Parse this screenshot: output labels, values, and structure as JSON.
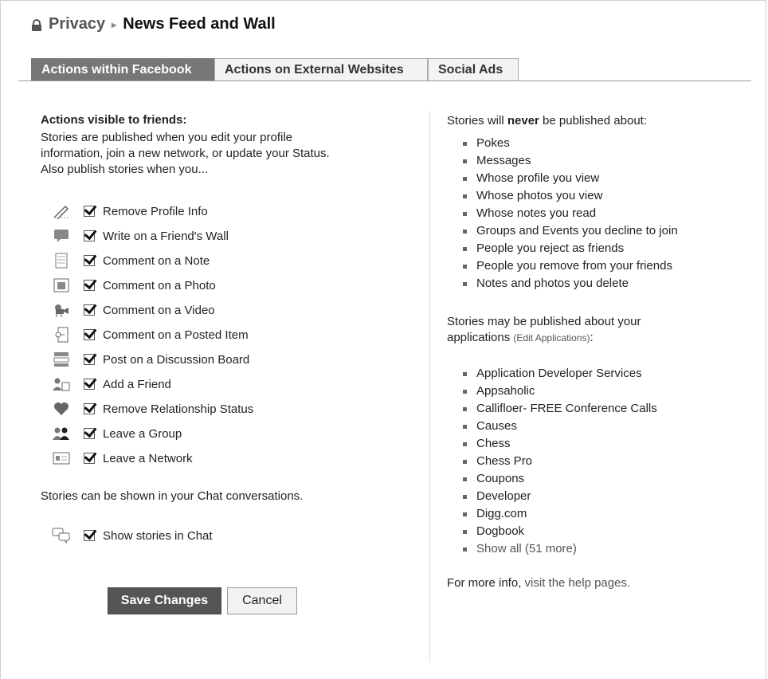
{
  "header": {
    "privacy": "Privacy",
    "separator": "▸",
    "current": "News Feed and Wall"
  },
  "tabs": [
    {
      "label": "Actions within Facebook",
      "active": true
    },
    {
      "label": "Actions on External Websites",
      "active": false
    },
    {
      "label": "Social Ads",
      "active": false
    }
  ],
  "left": {
    "heading": "Actions visible to friends:",
    "desc1": "Stories are published when you edit your profile",
    "desc2": "information, join a new network, or update your Status.",
    "desc3": "Also publish stories when you...",
    "options": [
      {
        "label": "Remove Profile Info",
        "icon": "pencil-icon",
        "checked": true
      },
      {
        "label": "Write on a Friend's Wall",
        "icon": "speech-bubble-icon",
        "checked": true
      },
      {
        "label": "Comment on a Note",
        "icon": "note-icon",
        "checked": true
      },
      {
        "label": "Comment on a Photo",
        "icon": "photo-icon",
        "checked": true
      },
      {
        "label": "Comment on a Video",
        "icon": "video-camera-icon",
        "checked": true
      },
      {
        "label": "Comment on a Posted Item",
        "icon": "posted-item-icon",
        "checked": true
      },
      {
        "label": "Post on a Discussion Board",
        "icon": "discussion-board-icon",
        "checked": true
      },
      {
        "label": "Add a Friend",
        "icon": "add-friend-icon",
        "checked": true
      },
      {
        "label": "Remove Relationship Status",
        "icon": "heart-icon",
        "checked": true
      },
      {
        "label": "Leave a Group",
        "icon": "group-icon",
        "checked": true
      },
      {
        "label": "Leave a Network",
        "icon": "network-icon",
        "checked": true
      }
    ],
    "chat_text": "Stories can be shown in your Chat conversations.",
    "chat_option": {
      "label": "Show stories in Chat",
      "icon": "chat-bubbles-icon",
      "checked": true
    }
  },
  "buttons": {
    "save": "Save Changes",
    "cancel": "Cancel"
  },
  "right": {
    "never_prefix": "Stories will ",
    "never_bold": "never",
    "never_suffix": " be published about:",
    "never_items": [
      "Pokes",
      "Messages",
      "Whose profile you view",
      "Whose photos you view",
      "Whose notes you read",
      "Groups and Events you decline to join",
      "People you reject as friends",
      "People you remove from your friends",
      "Notes and photos you delete"
    ],
    "apps_line1": "Stories may be published about your",
    "apps_line2": "applications ",
    "edit_apps": "(Edit Applications)",
    "colon": ":",
    "apps": [
      "Application Developer Services",
      "Appsaholic",
      "Callifloer- FREE Conference Calls",
      "Causes",
      "Chess",
      "Chess Pro",
      "Coupons",
      "Developer",
      "Digg.com",
      "Dogbook"
    ],
    "show_all": "Show all (51 more)",
    "more_info_prefix": "For more info, ",
    "more_info_link": "visit the help pages."
  }
}
